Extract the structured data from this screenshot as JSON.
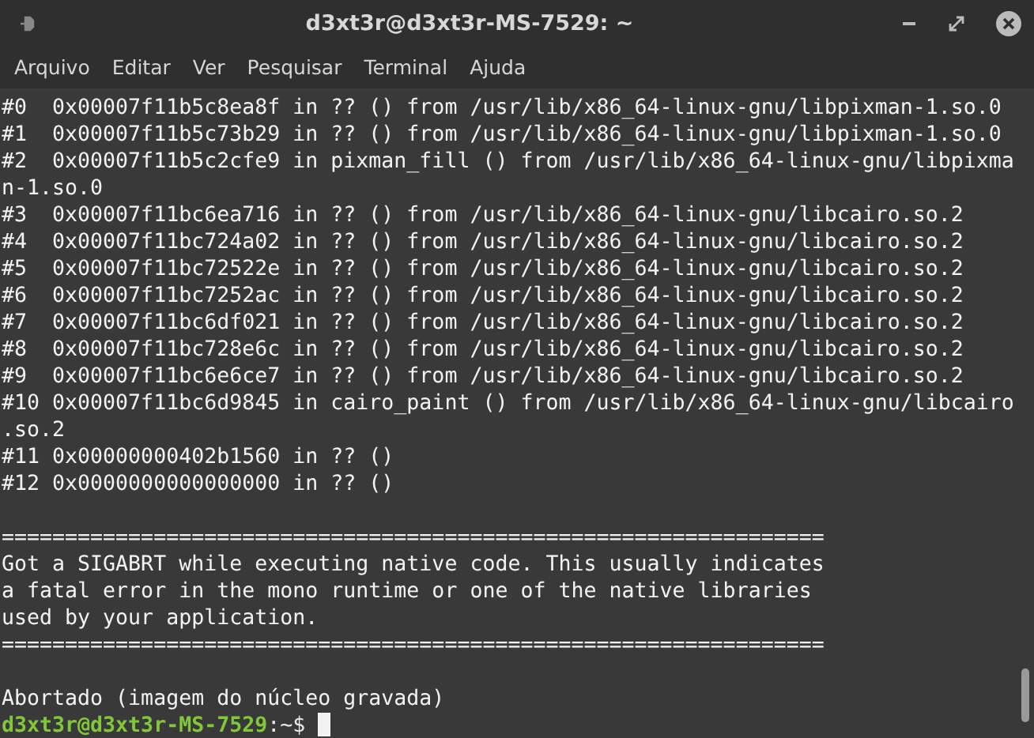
{
  "window": {
    "title": "d3xt3r@d3xt3r-MS-7529: ~"
  },
  "menu": [
    "Arquivo",
    "Editar",
    "Ver",
    "Pesquisar",
    "Terminal",
    "Ajuda"
  ],
  "terminal": {
    "lines": [
      "#0  0x00007f11b5c8ea8f in ?? () from /usr/lib/x86_64-linux-gnu/libpixman-1.so.0",
      "#1  0x00007f11b5c73b29 in ?? () from /usr/lib/x86_64-linux-gnu/libpixman-1.so.0",
      "#2  0x00007f11b5c2cfe9 in pixman_fill () from /usr/lib/x86_64-linux-gnu/libpixma",
      "n-1.so.0",
      "#3  0x00007f11bc6ea716 in ?? () from /usr/lib/x86_64-linux-gnu/libcairo.so.2",
      "#4  0x00007f11bc724a02 in ?? () from /usr/lib/x86_64-linux-gnu/libcairo.so.2",
      "#5  0x00007f11bc72522e in ?? () from /usr/lib/x86_64-linux-gnu/libcairo.so.2",
      "#6  0x00007f11bc7252ac in ?? () from /usr/lib/x86_64-linux-gnu/libcairo.so.2",
      "#7  0x00007f11bc6df021 in ?? () from /usr/lib/x86_64-linux-gnu/libcairo.so.2",
      "#8  0x00007f11bc728e6c in ?? () from /usr/lib/x86_64-linux-gnu/libcairo.so.2",
      "#9  0x00007f11bc6e6ce7 in ?? () from /usr/lib/x86_64-linux-gnu/libcairo.so.2",
      "#10 0x00007f11bc6d9845 in cairo_paint () from /usr/lib/x86_64-linux-gnu/libcairo",
      ".so.2",
      "#11 0x00000000402b1560 in ?? ()",
      "#12 0x0000000000000000 in ?? ()",
      {
        "text": "=================================================================",
        "blank_before": true
      },
      "Got a SIGABRT while executing native code. This usually indicates",
      "a fatal error in the mono runtime or one of the native libraries",
      "used by your application.",
      "=================================================================",
      {
        "text": "Abortado (imagem do núcleo gravada)",
        "blank_before": true
      }
    ],
    "prompt": {
      "user_host": "d3xt3r@d3xt3r-MS-7529",
      "path": ":~$"
    }
  }
}
